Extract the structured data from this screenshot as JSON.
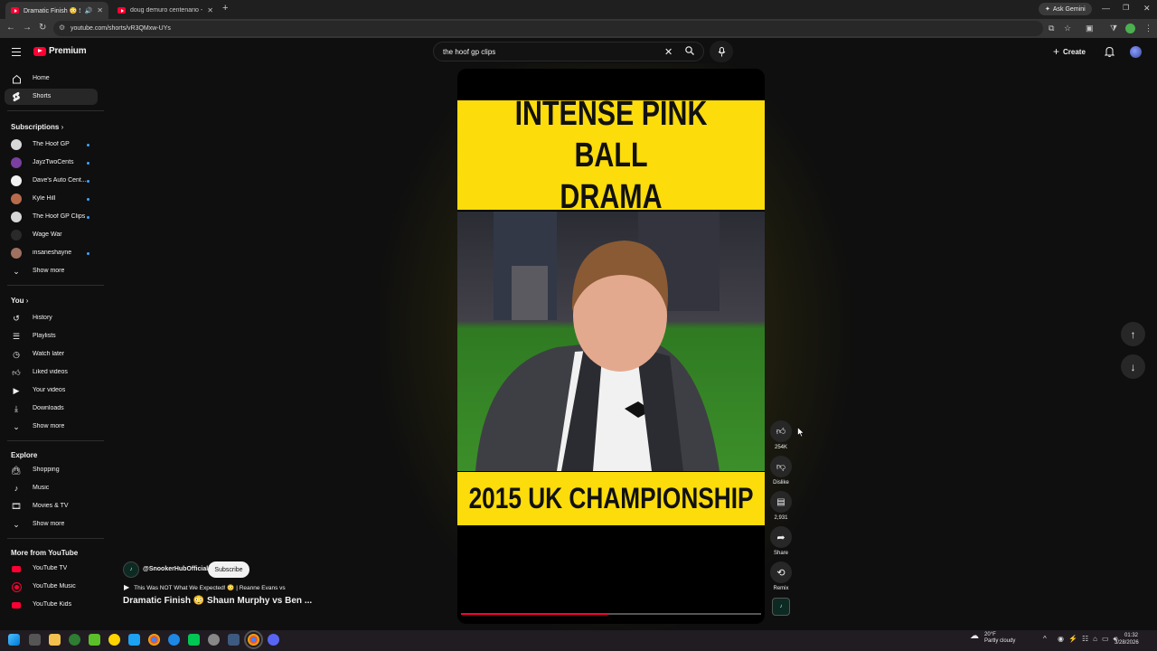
{
  "browser": {
    "tabs": [
      {
        "title": "Dramatic Finish 😳 Shaun M",
        "active": true
      },
      {
        "title": "doug demuro centenario - You",
        "active": false
      }
    ],
    "url": "youtube.com/shorts/vR3QMxw-UYs",
    "ask_gemini": "Ask Gemini"
  },
  "header": {
    "logo_text": "Premium",
    "search_query": "the hoof gp clips",
    "create_label": "Create"
  },
  "sidebar": {
    "home": "Home",
    "shorts": "Shorts",
    "subscriptions_heading": "Subscriptions",
    "subscriptions": [
      {
        "name": "The Hoof GP",
        "color": "#d8d8d8"
      },
      {
        "name": "JayzTwoCents",
        "color": "#7a3fa0"
      },
      {
        "name": "Dave's Auto Cent...",
        "color": "#f2f2f2"
      },
      {
        "name": "Kyle Hill",
        "color": "#b86b4b"
      },
      {
        "name": "The Hoof GP Clips",
        "color": "#d8d8d8"
      },
      {
        "name": "Wage War",
        "color": "#2a2a2a"
      },
      {
        "name": "insaneshayne",
        "color": "#a07060"
      }
    ],
    "show_more": "Show more",
    "you_heading": "You",
    "you_items": [
      "History",
      "Playlists",
      "Watch later",
      "Liked videos",
      "Your videos",
      "Downloads"
    ],
    "explore_heading": "Explore",
    "explore_items": [
      "Shopping",
      "Music",
      "Movies & TV"
    ],
    "more_heading": "More from YouTube",
    "more_items": [
      "YouTube TV",
      "YouTube Music",
      "YouTube Kids"
    ]
  },
  "short": {
    "top_text": "INTENSE PINK BALL\nDRAMA",
    "bottom_text": "2015 UK CHAMPIONSHIP",
    "progress": 0.49,
    "channel": "@SnookerHubOfficial",
    "subscribe_label": "Subscribe",
    "related": "This Was NOT What We Expected! 😳 | Reanne Evans vs",
    "title": "Dramatic Finish 😳 Shaun Murphy vs Ben ...",
    "likes": "254K",
    "dislike_label": "Dislike",
    "comments": "2,931",
    "share_label": "Share",
    "remix_label": "Remix"
  },
  "taskbar": {
    "temp": "20°F",
    "weather": "Partly cloudy",
    "time": "01:32",
    "date": "3/28/2026"
  }
}
